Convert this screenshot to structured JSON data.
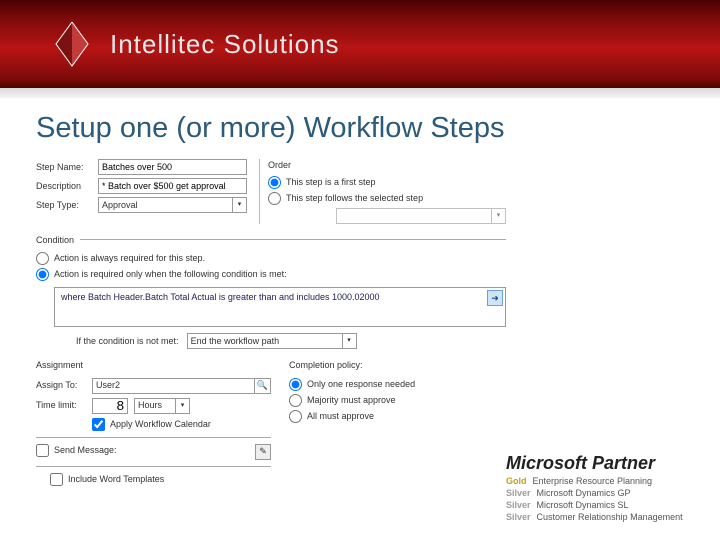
{
  "brand": "Intellitec Solutions",
  "slide_title": "Setup one (or more) Workflow Steps",
  "form": {
    "step_name_label": "Step Name:",
    "step_name_value": "Batches over 500",
    "description_label": "Description",
    "description_value": "* Batch over $500 get approval",
    "step_type_label": "Step Type:",
    "step_type_value": "Approval",
    "order_legend": "Order",
    "radio_first_step": "This step is a first step",
    "radio_follows": "This step follows the selected step",
    "condition_legend": "Condition",
    "radio_always": "Action is always required for this step.",
    "radio_cond": "Action is required only when the following condition is met:",
    "condition_text": "where Batch Header.Batch Total Actual is greater than and includes 1000.02000",
    "not_met_label": "If the condition is not met:",
    "not_met_value": "End the workflow path",
    "assignment_legend": "Assignment",
    "assign_to_label": "Assign To:",
    "assign_to_value": "User2",
    "time_limit_label": "Time limit:",
    "time_limit_value": "8",
    "time_limit_unit": "Hours",
    "apply_calendar": "Apply Workflow Calendar",
    "send_message": "Send Message:",
    "include_templates": "Include Word Templates",
    "completion_label": "Completion policy:",
    "cp_one": "Only one response needed",
    "cp_majority": "Majority must approve",
    "cp_all": "All must approve"
  },
  "partner": {
    "title": "Microsoft Partner",
    "lines": [
      {
        "tag": "Gold",
        "tagClass": "gold",
        "text": "Enterprise Resource Planning"
      },
      {
        "tag": "Silver",
        "tagClass": "silv",
        "text": "Microsoft Dynamics GP"
      },
      {
        "tag": "Silver",
        "tagClass": "silv",
        "text": "Microsoft Dynamics SL"
      },
      {
        "tag": "Silver",
        "tagClass": "silv",
        "text": "Customer Relationship Management"
      }
    ]
  }
}
